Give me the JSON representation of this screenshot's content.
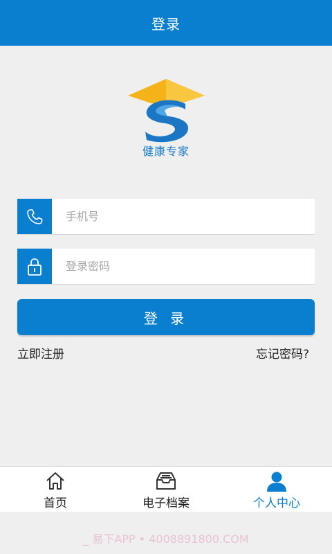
{
  "header": {
    "title": "登录"
  },
  "logo": {
    "brand_text": "健康专家"
  },
  "form": {
    "phone": {
      "placeholder": "手机号",
      "value": ""
    },
    "password": {
      "placeholder": "登录密码",
      "value": ""
    },
    "login_label": "登 录",
    "register_label": "立即注册",
    "forgot_label": "忘记密码?"
  },
  "tabs": [
    {
      "label": "首页",
      "icon": "home-icon",
      "active": false
    },
    {
      "label": "电子档案",
      "icon": "inbox-icon",
      "active": false
    },
    {
      "label": "个人中心",
      "icon": "person-icon",
      "active": true
    }
  ],
  "watermark": "_ 易下APP • 4008891800.COM",
  "colors": {
    "primary": "#0a7fd0",
    "background": "#efefef",
    "logo_cap": "#f5b319"
  }
}
